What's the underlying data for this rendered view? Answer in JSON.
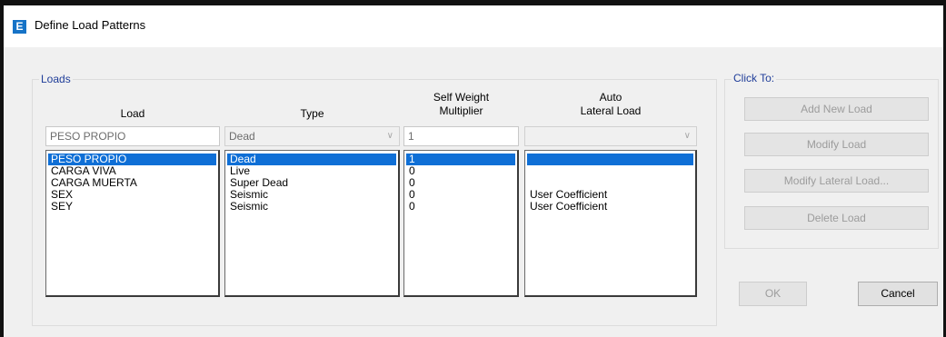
{
  "window": {
    "title": "Define Load Patterns",
    "icon_letter": "E"
  },
  "loads_group": {
    "label": "Loads"
  },
  "columns": {
    "load": "Load",
    "type": "Type",
    "multiplier_line1": "Self Weight",
    "multiplier_line2": "Multiplier",
    "auto_line1": "Auto",
    "auto_line2": "Lateral Load"
  },
  "entry": {
    "load": "PESO PROPIO",
    "type": "Dead",
    "multiplier": "1",
    "auto": ""
  },
  "rows": [
    {
      "load": "PESO PROPIO",
      "type": "Dead",
      "multiplier": "1",
      "auto": "",
      "selected": true
    },
    {
      "load": "CARGA VIVA",
      "type": "Live",
      "multiplier": "0",
      "auto": "",
      "selected": false
    },
    {
      "load": "CARGA MUERTA",
      "type": "Super Dead",
      "multiplier": "0",
      "auto": "",
      "selected": false
    },
    {
      "load": "SEX",
      "type": "Seismic",
      "multiplier": "0",
      "auto": "User Coefficient",
      "selected": false
    },
    {
      "load": "SEY",
      "type": "Seismic",
      "multiplier": "0",
      "auto": "User Coefficient",
      "selected": false
    }
  ],
  "click_to": {
    "label": "Click To:",
    "add": "Add New Load",
    "modify": "Modify Load",
    "modify_lateral": "Modify Lateral Load...",
    "delete": "Delete Load"
  },
  "buttons": {
    "ok": "OK",
    "cancel": "Cancel"
  },
  "colors": {
    "selection": "#0f6fd6",
    "group_label": "#1f3d99",
    "app_icon": "#1673c7"
  }
}
